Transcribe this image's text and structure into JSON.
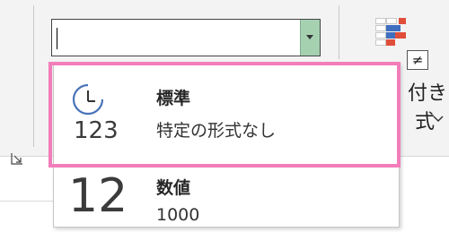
{
  "number_format_combo": {
    "value": ""
  },
  "conditional_format": {
    "neq_symbol": "≠",
    "label_part1": "付き",
    "label_part2": "式"
  },
  "dropdown": {
    "items": [
      {
        "icon": "clock-icon",
        "icon_text": "123",
        "title": "標準",
        "subtitle": "特定の形式なし"
      },
      {
        "icon": "number-icon",
        "icon_text": "12",
        "title": "数値",
        "subtitle": "1000"
      }
    ]
  },
  "colors": {
    "highlight": "#f27db9",
    "combo_button": "#a5d1b1",
    "clock_blue": "#4a73b8"
  }
}
